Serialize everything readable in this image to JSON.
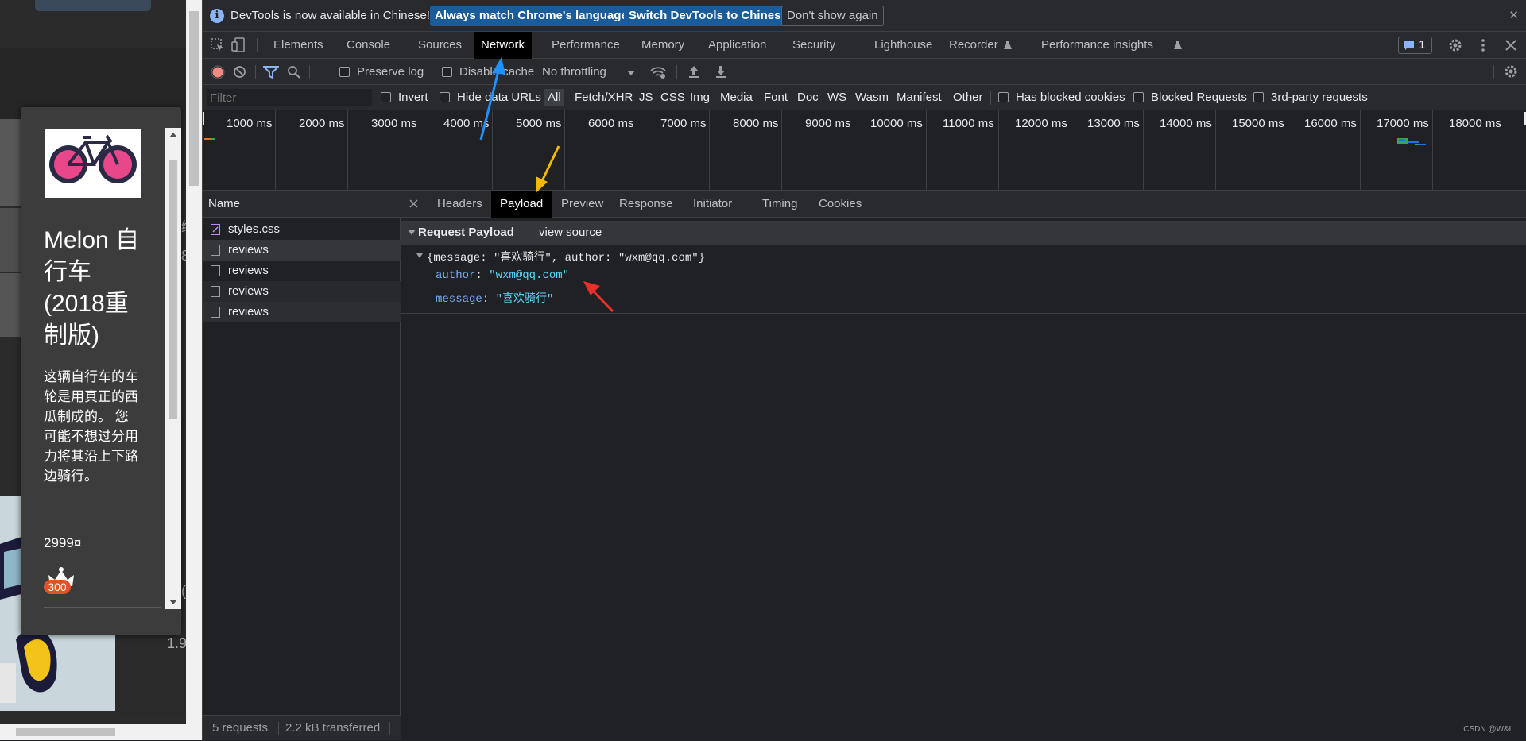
{
  "page": {
    "product_title": "Melon 自行车 (2018重制版)",
    "description": "这辆自行车的车轮是用真正的西瓜制成的。 您可能不想过分用力将其沿上下路边骑行。",
    "price": "2999¤",
    "badge_count": "300",
    "side_glyph_1": "绑",
    "side_glyph_2": "8",
    "side_glyph_3": "(",
    "side_price_fragment": "1.9"
  },
  "infobar": {
    "message": "DevTools is now available in Chinese!",
    "btn_match": "Always match Chrome's language",
    "btn_switch": "Switch DevTools to Chinese",
    "btn_dismiss": "Don't show again",
    "close": "✕"
  },
  "tabs": [
    "Elements",
    "Console",
    "Sources",
    "Network",
    "Performance",
    "Memory",
    "Application",
    "Security",
    "Lighthouse",
    "Recorder",
    "Performance insights"
  ],
  "issues_count": "1",
  "toolbar": {
    "preserve_log": "Preserve log",
    "disable_cache": "Disable cache",
    "throttling": "No throttling"
  },
  "filter": {
    "placeholder": "Filter",
    "invert": "Invert",
    "hide_data_urls": "Hide data URLs",
    "types": [
      "All",
      "Fetch/XHR",
      "JS",
      "CSS",
      "Img",
      "Media",
      "Font",
      "Doc",
      "WS",
      "Wasm",
      "Manifest",
      "Other"
    ],
    "has_blocked_cookies": "Has blocked cookies",
    "blocked_requests": "Blocked Requests",
    "third_party": "3rd-party requests"
  },
  "timeline": {
    "ticks": [
      "1000 ms",
      "2000 ms",
      "3000 ms",
      "4000 ms",
      "5000 ms",
      "6000 ms",
      "7000 ms",
      "8000 ms",
      "9000 ms",
      "10000 ms",
      "11000 ms",
      "12000 ms",
      "13000 ms",
      "14000 ms",
      "15000 ms",
      "16000 ms",
      "17000 ms",
      "18000 ms"
    ]
  },
  "requests": {
    "header": "Name",
    "items": [
      "styles.css",
      "reviews",
      "reviews",
      "reviews",
      "reviews"
    ],
    "status_count": "5 requests",
    "status_transferred": "2.2 kB transferred"
  },
  "detail": {
    "tabs": [
      "Headers",
      "Payload",
      "Preview",
      "Response",
      "Initiator",
      "Timing",
      "Cookies"
    ],
    "section_title": "Request Payload",
    "view_source": "view source",
    "summary": "{message: \"喜欢骑行\", author: \"wxm@qq.com\"}",
    "fields": [
      {
        "key": "author",
        "value": "\"wxm@qq.com\""
      },
      {
        "key": "message",
        "value": "\"喜欢骑行\""
      }
    ],
    "watermark": "CSDN @W&L."
  },
  "colors": {
    "accent_blue": "#1a5c99",
    "arrow_blue": "#1e90ff",
    "arrow_yellow": "#f5b700",
    "arrow_red": "#e8302a",
    "record_red": "#f28b82"
  }
}
